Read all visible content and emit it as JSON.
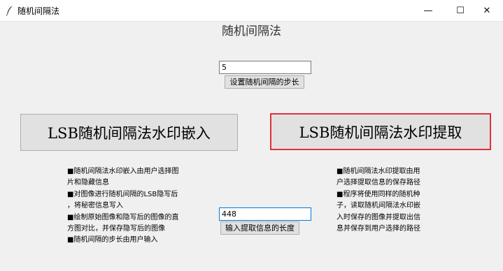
{
  "window": {
    "title": "随机间隔法",
    "minimize_glyph": "—",
    "maximize_glyph": "☐",
    "close_glyph": "✕",
    "icon": "feather-icon"
  },
  "heading": "随机间隔法",
  "step": {
    "value": "5",
    "button_label": "设置随机间隔的步长"
  },
  "embed_button_label": "LSB随机间隔法水印嵌入",
  "extract_button_label": "LSB随机间隔法水印提取",
  "embed_description": [
    "■随机间隔法水印嵌入由用户选择图",
    "片和隐藏信息",
    "■对图像进行随机间隔的LSB隐写后",
    "，将秘密信息写入",
    "■绘制原始图像和隐写后的图像的直",
    "方图对比，并保存隐写后的图像",
    "■随机间隔的步长由用户输入"
  ],
  "extract_description": [
    "■随机间隔法水印提取由用",
    "户选择提取信息的保存路径",
    "■程序将使用同样的随机种",
    "子，读取随机间隔法水印嵌",
    "入时保存的图像并提取出信",
    "息并保存到用户选择的路径"
  ],
  "length": {
    "value": "448",
    "button_label": "输入提取信息的长度"
  }
}
